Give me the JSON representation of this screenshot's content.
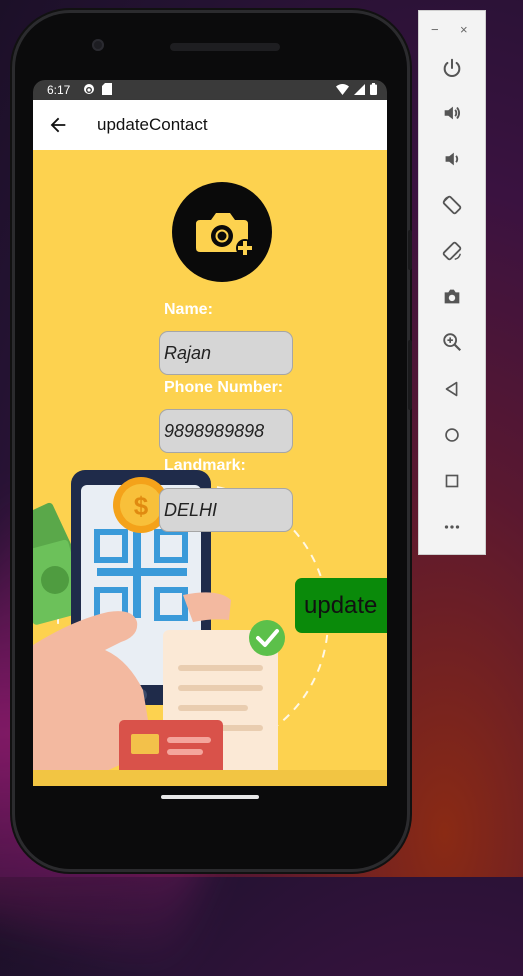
{
  "status_bar": {
    "time": "6:17"
  },
  "app_bar": {
    "title": "updateContact"
  },
  "form": {
    "name_label": "Name:",
    "name_value": "Rajan",
    "phone_label": "Phone Number:",
    "phone_value": "9898989898",
    "landmark_label": "Landmark:",
    "landmark_value": "DELHI",
    "update_label": "update"
  },
  "emulator_toolbar": {
    "minimize_glyph": "−",
    "close_glyph": "×",
    "buttons": [
      "power-icon",
      "volume-up-icon",
      "volume-down-icon",
      "rotate-left-icon",
      "rotate-right-icon",
      "screenshot-icon",
      "zoom-icon",
      "back-icon",
      "home-icon",
      "overview-icon",
      "more-icon"
    ]
  },
  "colors": {
    "screen_background": "#fdd24f",
    "update_button": "#0a8a0a",
    "input_background": "#d6d6d6",
    "status_bar": "#3a3a3a"
  }
}
